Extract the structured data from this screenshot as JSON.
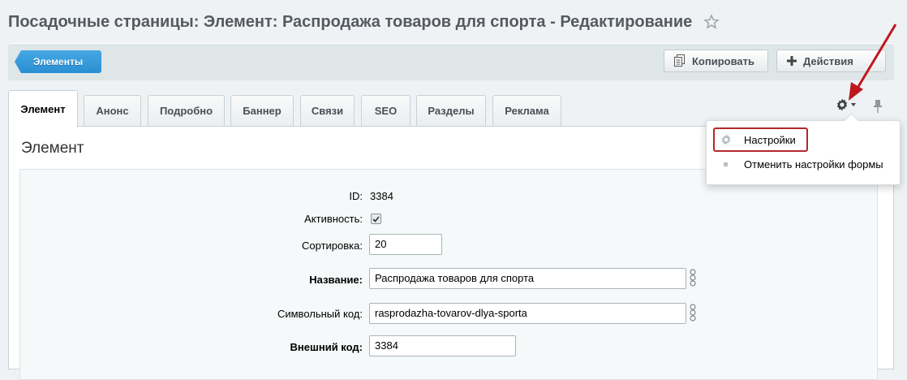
{
  "page": {
    "title": "Посадочные страницы: Элемент: Распродажа товаров для спорта - Редактирование"
  },
  "toolbar": {
    "elements_label": "Элементы",
    "copy_label": "Копировать",
    "actions_label": "Действия"
  },
  "tabs": [
    {
      "label": "Элемент"
    },
    {
      "label": "Анонс"
    },
    {
      "label": "Подробно"
    },
    {
      "label": "Баннер"
    },
    {
      "label": "Связи"
    },
    {
      "label": "SEO"
    },
    {
      "label": "Разделы"
    },
    {
      "label": "Реклама"
    }
  ],
  "section": {
    "title": "Элемент"
  },
  "form": {
    "id_label": "ID:",
    "id_value": "3384",
    "active_label": "Активность:",
    "active_checked": true,
    "sort_label": "Сортировка:",
    "sort_value": "20",
    "name_label": "Название:",
    "name_value": "Распродажа товаров для спорта",
    "code_label": "Символьный код:",
    "code_value": "rasprodazha-tovarov-dlya-sporta",
    "xml_label": "Внешний код:",
    "xml_value": "3384"
  },
  "settings_menu": {
    "items": [
      {
        "label": "Настройки",
        "icon": "gear-icon"
      },
      {
        "label": "Отменить настройки формы",
        "icon": "bullet-icon"
      }
    ]
  },
  "colors": {
    "accent_blue": "#2a8fd2",
    "highlight_red": "#b3272d",
    "arrow_red": "#c0161e"
  }
}
